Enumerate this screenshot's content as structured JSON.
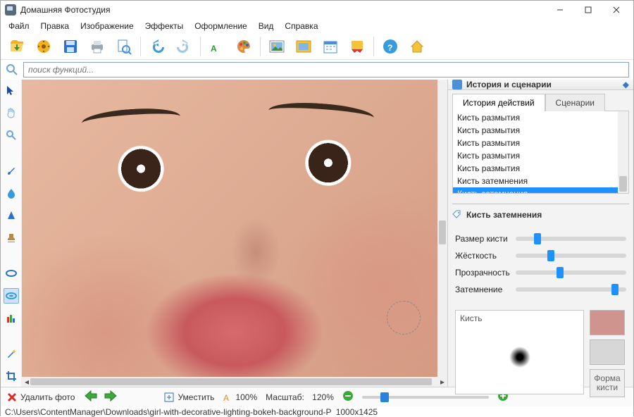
{
  "title": "Домашняя Фотостудия",
  "menu": [
    "Файл",
    "Правка",
    "Изображение",
    "Эффекты",
    "Оформление",
    "Вид",
    "Справка"
  ],
  "search": {
    "placeholder": "поиск функций..."
  },
  "right": {
    "title": "История и сценарии",
    "tabs": {
      "history": "История действий",
      "scenarios": "Сценарии"
    },
    "history_items": [
      "Кисть размытия",
      "Кисть размытия",
      "Кисть размытия",
      "Кисть размытия",
      "Кисть размытия",
      "Кисть затемнения",
      "Кисть затемнения"
    ],
    "history_sel": 6,
    "subsection": "Кисть затемнения",
    "sliders": {
      "size": {
        "label": "Размер кисти",
        "pct": 20
      },
      "hard": {
        "label": "Жёсткость",
        "pct": 32
      },
      "opac": {
        "label": "Прозрачность",
        "pct": 40
      },
      "dark": {
        "label": "Затемнение",
        "pct": 90
      }
    },
    "brush_label": "Кисть",
    "swatch1": "#cf948d",
    "swatch2": "#d7d7d7",
    "shape_btn_l1": "Форма",
    "shape_btn_l2": "кисти"
  },
  "bottom": {
    "delete": "Удалить фото",
    "fit": "Уместить",
    "text_zoom": "100%",
    "scale_label": "Масштаб:",
    "scale_value": "120%",
    "zoom_thumb_pct": 18
  },
  "status": {
    "path": "C:\\Users\\ContentManager\\Downloads\\girl-with-decorative-lighting-bokeh-background-P",
    "dims": "1000x1425"
  }
}
